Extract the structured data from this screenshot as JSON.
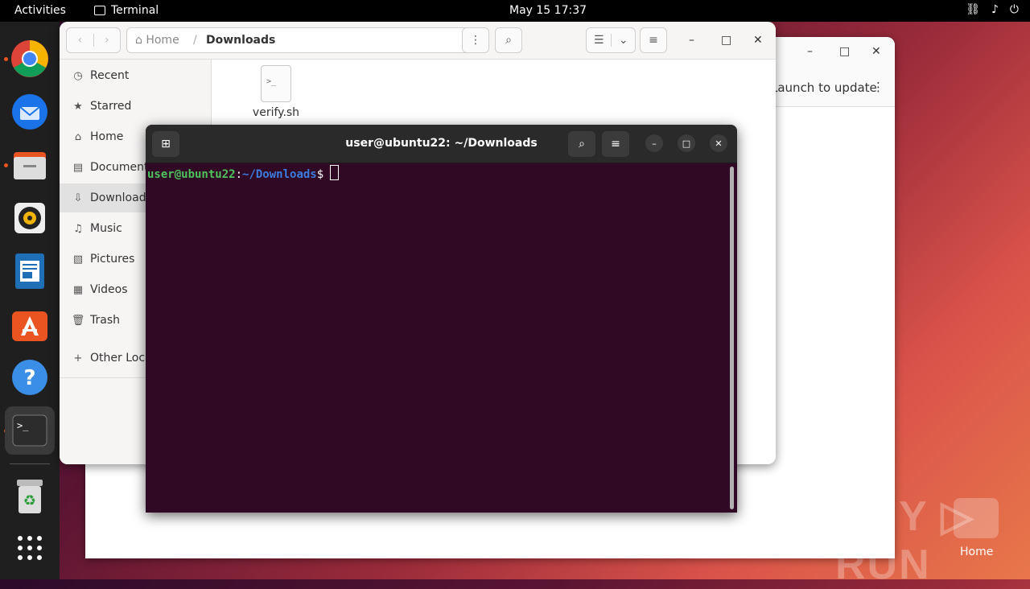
{
  "topbar": {
    "activities": "Activities",
    "app_name": "Terminal",
    "clock": "May 15  17:37",
    "tray": [
      "⌂",
      "🔊",
      "⏻"
    ]
  },
  "dock": {
    "apps": [
      "chrome-icon",
      "thunderbird-icon",
      "files-icon",
      "rhythmbox-icon",
      "writer-icon",
      "app-center-icon",
      "help-icon",
      "terminal-icon",
      "trash-icon",
      "show-apps-icon"
    ]
  },
  "updater": {
    "launch_text": "Launch to update",
    "minimize": "–",
    "maximize": "□",
    "close": "✕"
  },
  "files": {
    "path_home": "Home",
    "path_current": "Downloads",
    "sidebar": [
      {
        "label": "Recent",
        "icon": "◷"
      },
      {
        "label": "Starred",
        "icon": "★"
      },
      {
        "label": "Home",
        "icon": "⌂"
      },
      {
        "label": "Documents",
        "icon": "▤"
      },
      {
        "label": "Downloads",
        "icon": "⇩"
      },
      {
        "label": "Music",
        "icon": "♫"
      },
      {
        "label": "Pictures",
        "icon": "▧"
      },
      {
        "label": "Videos",
        "icon": "▦"
      },
      {
        "label": "Trash",
        "icon": "🗑"
      }
    ],
    "other_locations": "Other Locations",
    "file": {
      "name": "verify.sh",
      "icon_text": ">_"
    }
  },
  "terminal": {
    "title": "user@ubuntu22: ~/Downloads",
    "prompt_user": "user@ubuntu22",
    "prompt_path": "~/Downloads",
    "prompt_dollar": "$"
  },
  "desktop": {
    "watermark": "ANY ▷ RUN",
    "home_label": "Home"
  }
}
